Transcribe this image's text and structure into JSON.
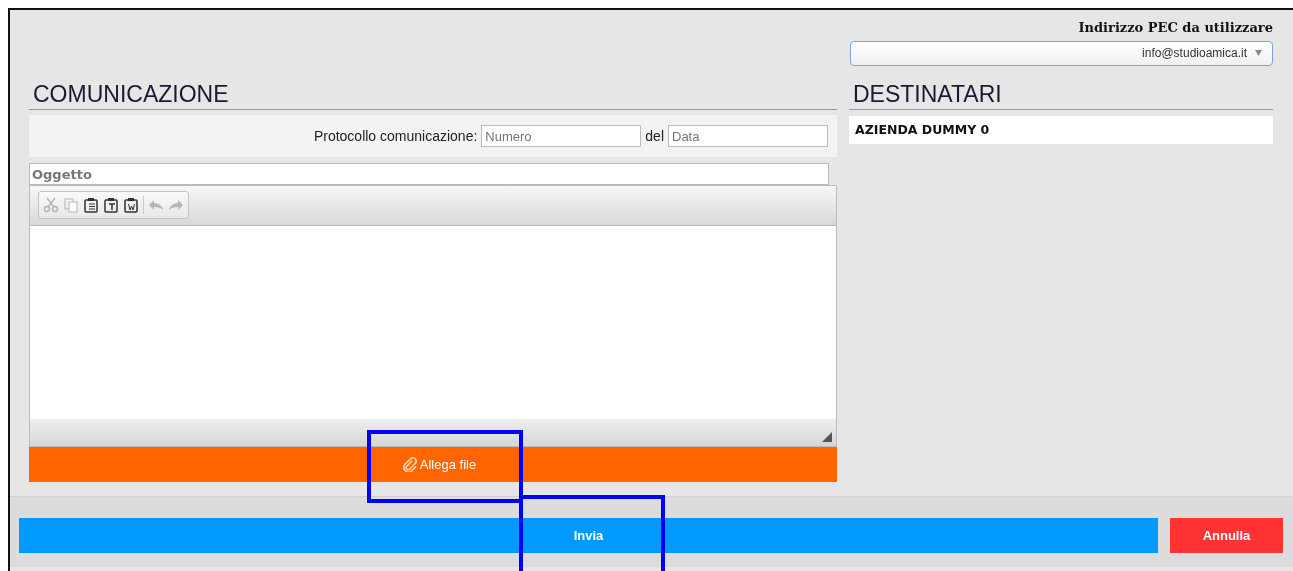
{
  "pec": {
    "label": "Indirizzo PEC da utilizzare",
    "value": "info@studioamica.it"
  },
  "communication": {
    "title": "COMUNICAZIONE",
    "protocol_label": "Protocollo comunicazione:",
    "number_placeholder": "Numero",
    "date_label": "del",
    "date_placeholder": "Data",
    "subject_placeholder": "Oggetto",
    "toolbar": [
      {
        "kind": "cut",
        "disabled": true
      },
      {
        "kind": "copy",
        "disabled": true
      },
      {
        "kind": "paste",
        "disabled": false
      },
      {
        "kind": "paste-text",
        "disabled": false
      },
      {
        "kind": "paste-word",
        "disabled": false
      },
      {
        "kind": "undo",
        "disabled": true
      },
      {
        "kind": "redo",
        "disabled": true
      }
    ],
    "attach_button": {
      "label": "Allega file",
      "highlighted": true
    }
  },
  "recipients": {
    "title": "DESTINATARI",
    "items": [
      "AZIENDA DUMMY 0"
    ]
  },
  "footer": {
    "send_button": {
      "label": "Invia",
      "highlighted": true
    },
    "cancel_button": {
      "label": "Annulla"
    }
  }
}
